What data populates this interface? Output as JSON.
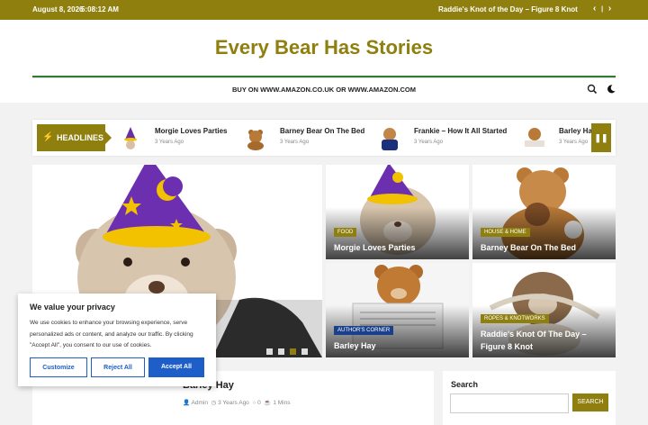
{
  "topbar": {
    "date": "August 8, 2026",
    "time": "5:08:12 AM",
    "ticker": "Raddie's Knot of the Day – Figure 8 Knot",
    "prev_icon": "chevron-left-icon",
    "next_icon": "chevron-right-icon",
    "separator": "|"
  },
  "site": {
    "title": "Every Bear Has Stories"
  },
  "nav": {
    "label": "BUY ON WWW.AMAZON.CO.UK OR WWW.AMAZON.COM"
  },
  "headlines": {
    "label": "HEADLINES",
    "items": [
      {
        "title": "Morgie Loves Parties",
        "date": "3 Years Ago"
      },
      {
        "title": "Barney Bear On The Bed",
        "date": "3 Years Ago"
      },
      {
        "title": "Frankie – How It All Started",
        "date": "3 Years Ago"
      },
      {
        "title": "Barley Ha",
        "date": "3 Years Ago"
      }
    ]
  },
  "grid": {
    "cards": [
      {
        "category": "FOOD",
        "title": "Morgie Loves Parties",
        "cat_color": "#8e7f0e"
      },
      {
        "category": "HOUSE & HOME",
        "title": "Barney Bear On The Bed",
        "cat_color": "#8e7f0e"
      },
      {
        "category": "AUTHOR'S CORNER",
        "title": "Barley Hay",
        "cat_color": "#1a3f8b"
      },
      {
        "category": "ROPES & KNOTWORKS",
        "title": "Raddie's Knot Of The Day – Figure 8 Knot",
        "cat_color": "#8e7f0e"
      }
    ]
  },
  "main_post": {
    "title": "Barley Hay",
    "author": "Admin",
    "date": "3 Years Ago",
    "comments": "0",
    "read_time": "1 Mins"
  },
  "sidebar": {
    "search_title": "Search",
    "search_button": "SEARCH"
  },
  "cookie": {
    "title": "We value your privacy",
    "text": "We use cookies to enhance your browsing experience, serve personalized ads or content, and analyze our traffic. By clicking \"Accept All\", you consent to our use of cookies.",
    "customize": "Customize",
    "reject": "Reject All",
    "accept": "Accept All"
  },
  "colors": {
    "accent": "#8e7f0e",
    "cookie_blue": "#1d5ec8"
  }
}
